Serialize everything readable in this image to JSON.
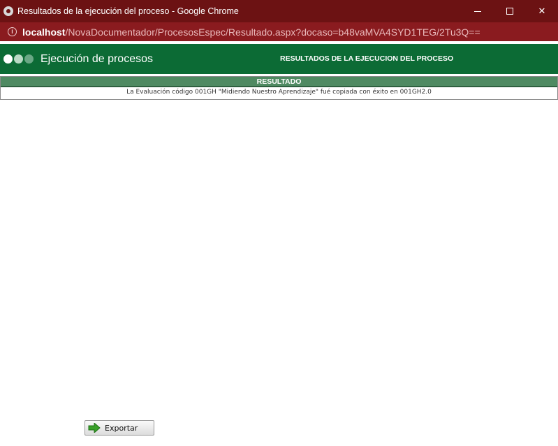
{
  "window": {
    "title": "Resultados de la ejecución del proceso - Google Chrome",
    "minimize_icon": "minimize-icon",
    "maximize_icon": "maximize-icon",
    "close_label": "✕"
  },
  "address": {
    "host": "localhost",
    "path": "/NovaDocumentador/ProcesosEspec/Resultado.aspx?docaso=b48vaMVA4SYD1TEG/2Tu3Q=="
  },
  "header": {
    "app_title": "Ejecución de procesos",
    "page_title": "RESULTADOS DE LA EJECUCION DEL PROCESO"
  },
  "result": {
    "heading": "RESULTADO",
    "message": "La Evaluación código 001GH \"Midiendo Nuestro Aprendizaje\" fué copiada con éxito en 001GH2.0"
  },
  "actions": {
    "export_label": "Exportar"
  },
  "colors": {
    "titlebar": "#6c1213",
    "addressbar": "#8a1b1f",
    "header": "#0c6b35",
    "result_header": "#4f8a62",
    "export_arrow": "#3aa12a"
  }
}
